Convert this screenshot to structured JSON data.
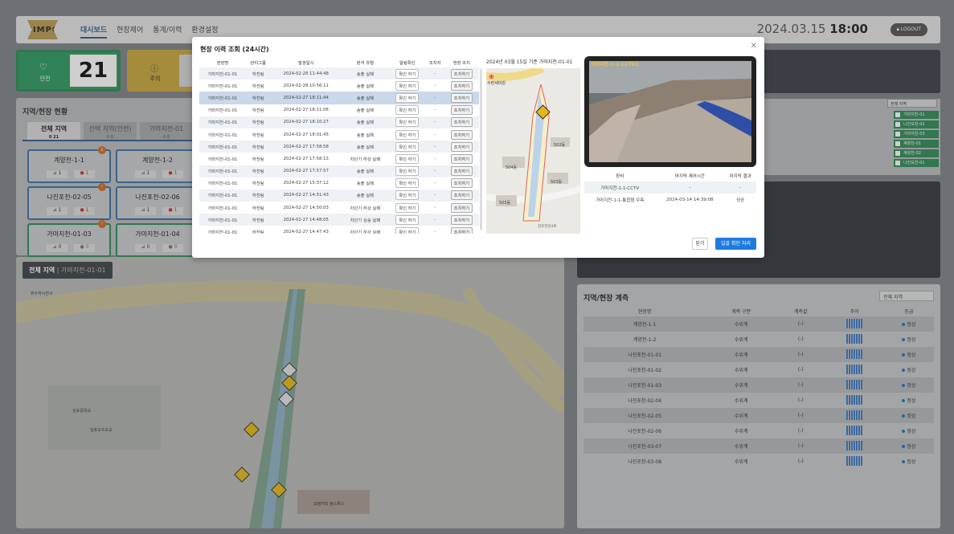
{
  "header": {
    "logo": "GIMPO",
    "nav": [
      "대시보드",
      "현장제어",
      "통계/이력",
      "환경설정"
    ],
    "date": "2024.03.15",
    "time": "18:00",
    "logout": "LOGOUT"
  },
  "status": {
    "safe_label": "안전",
    "safe_count": "21",
    "warn_label": "주의"
  },
  "region": {
    "title": "지역/현장 현황",
    "tabs": [
      {
        "label": "전체 지역",
        "count": "0 21"
      },
      {
        "label": "선택 지역(안전)",
        "count": "0 0"
      },
      {
        "label": "가마지전-01",
        "count": "0 8"
      }
    ],
    "sites": [
      {
        "name": "계양천-1-1",
        "a": "1",
        "b": "1",
        "badge": "1"
      },
      {
        "name": "계양천-1-2",
        "a": "1",
        "b": "1",
        "badge": ""
      },
      {
        "name": "나진포천-02-05",
        "a": "1",
        "b": "1",
        "badge": "!"
      },
      {
        "name": "나진포천-02-06",
        "a": "1",
        "b": "1",
        "badge": ""
      },
      {
        "name": "가마지천-01-03",
        "a": "0",
        "b": "0",
        "badge": "!"
      },
      {
        "name": "가마지천-01-04",
        "a": "0",
        "b": "0",
        "badge": ""
      }
    ]
  },
  "map": {
    "title": "전체 지역",
    "subtitle": "| 가마지천-01-01",
    "labels": [
      "김포중학교",
      "김포오수초교",
      "위수하시전구",
      "모정커피 울스튜스"
    ]
  },
  "right_filter": "전체 지역",
  "checklist": [
    "가마지천-01",
    "나진포천-02",
    "가마지천-03",
    "계양천-01",
    "계양천-02",
    "나진포천-01"
  ],
  "measure": {
    "title": "지역/현장 계측",
    "select": "전체 지역",
    "headers": [
      "현장명",
      "계측 구분",
      "계측값",
      "추이",
      "등급"
    ],
    "rows": [
      {
        "name": "계양천-1-1",
        "type": "수위계",
        "value": "(-)",
        "grade": "정상"
      },
      {
        "name": "계양천-1-2",
        "type": "수위계",
        "value": "(-)",
        "grade": "정상"
      },
      {
        "name": "나진포천-01-01",
        "type": "수위계",
        "value": "(-)",
        "grade": "정상"
      },
      {
        "name": "나진포천-01-02",
        "type": "수위계",
        "value": "(-)",
        "grade": "정상"
      },
      {
        "name": "나진포천-01-03",
        "type": "수위계",
        "value": "(-)",
        "grade": "정상"
      },
      {
        "name": "나진포천-02-04",
        "type": "수위계",
        "value": "(-)",
        "grade": "정상"
      },
      {
        "name": "나진포천-02-05",
        "type": "수위계",
        "value": "(-)",
        "grade": "정상"
      },
      {
        "name": "나진포천-02-06",
        "type": "수위계",
        "value": "(-)",
        "grade": "정상"
      },
      {
        "name": "나진포천-03-07",
        "type": "수위계",
        "value": "(-)",
        "grade": "정상"
      },
      {
        "name": "나진포천-03-08",
        "type": "수위계",
        "value": "(-)",
        "grade": "정상"
      }
    ]
  },
  "modal": {
    "title": "현장 이력 조회 (24시간)",
    "headers": [
      "현장명",
      "관리그룹",
      "발생일시",
      "분석 유형",
      "알림확인",
      "조치자",
      "현장 조치"
    ],
    "rows": [
      {
        "site": "가마지천-01-01",
        "group": "하천팀",
        "time": "2024-02-28 11:44:48",
        "type": "송출 실패",
        "check": "확인 하기",
        "by": "-",
        "act": "조치하기"
      },
      {
        "site": "가마지천-01-01",
        "group": "하천팀",
        "time": "2024-02-28 10:56:11",
        "type": "송출 실패",
        "check": "확인 하기",
        "by": "-",
        "act": "조치하기"
      },
      {
        "site": "가마지천-01-01",
        "group": "하천팀",
        "time": "2024-02-27 18:11:44",
        "type": "송출 실패",
        "check": "확인 하기",
        "by": "-",
        "act": "조치하기"
      },
      {
        "site": "가마지천-01-01",
        "group": "하천팀",
        "time": "2024-02-27 18:11:06",
        "type": "송출 실패",
        "check": "확인 하기",
        "by": "-",
        "act": "조치하기"
      },
      {
        "site": "가마지천-01-01",
        "group": "하천팀",
        "time": "2024-02-27 18:10:27",
        "type": "송출 실패",
        "check": "확인 하기",
        "by": "-",
        "act": "조치하기"
      },
      {
        "site": "가마지천-01-01",
        "group": "하천팀",
        "time": "2024-02-27 18:01:45",
        "type": "송출 실패",
        "check": "확인 하기",
        "by": "-",
        "act": "조치하기"
      },
      {
        "site": "가마지천-01-01",
        "group": "하천팀",
        "time": "2024-02-27 17:58:58",
        "type": "송출 실패",
        "check": "확인 하기",
        "by": "-",
        "act": "조치하기"
      },
      {
        "site": "가마지천-01-01",
        "group": "하천팀",
        "time": "2024-02-27 17:58:13",
        "type": "차단기 하강 실패",
        "check": "확인 하기",
        "by": "-",
        "act": "조치하기"
      },
      {
        "site": "가마지천-01-01",
        "group": "하천팀",
        "time": "2024-02-27 17:57:57",
        "type": "송출 실패",
        "check": "확인 하기",
        "by": "-",
        "act": "조치하기"
      },
      {
        "site": "가마지천-01-01",
        "group": "하천팀",
        "time": "2024-02-27 15:37:12",
        "type": "송출 실패",
        "check": "확인 하기",
        "by": "-",
        "act": "조치하기"
      },
      {
        "site": "가마지천-01-01",
        "group": "하천팀",
        "time": "2024-02-27 14:51:43",
        "type": "송출 실패",
        "check": "확인 하기",
        "by": "-",
        "act": "조치하기"
      },
      {
        "site": "가마지천-01-01",
        "group": "하천팀",
        "time": "2024-02-27 14:50:03",
        "type": "차단기 하강 실패",
        "check": "확인 하기",
        "by": "-",
        "act": "조치하기"
      },
      {
        "site": "가마지천-01-01",
        "group": "하천팀",
        "time": "2024-02-27 14:48:05",
        "type": "차단기 상승 실패",
        "check": "확인 하기",
        "by": "-",
        "act": "조치하기"
      },
      {
        "site": "가마지천-01-01",
        "group": "하천팀",
        "time": "2024-02-27 14:47:43",
        "type": "차단기 하강 실패",
        "check": "확인 하기",
        "by": "-",
        "act": "조치하기"
      }
    ],
    "map_info": "2024년 03월 15일 기준 가마지천-01-01",
    "map_labels": [
      "수련세미원",
      "502동",
      "504동",
      "503동",
      "505동",
      "김포한강4로"
    ],
    "cam_label": "가마지천-1-1-CCTV2",
    "device_headers": [
      "장비",
      "마지막 제어시간",
      "마지막 결과"
    ],
    "devices": [
      {
        "name": "가마지천-1-1-CCTV",
        "time": "-",
        "result": "-"
      },
      {
        "name": "가마지천-1-1-통합형 우측",
        "time": "2024-03-14 14:39:08",
        "result": "성공"
      }
    ],
    "close": "닫기",
    "confirm": "일괄 확인 처리"
  }
}
